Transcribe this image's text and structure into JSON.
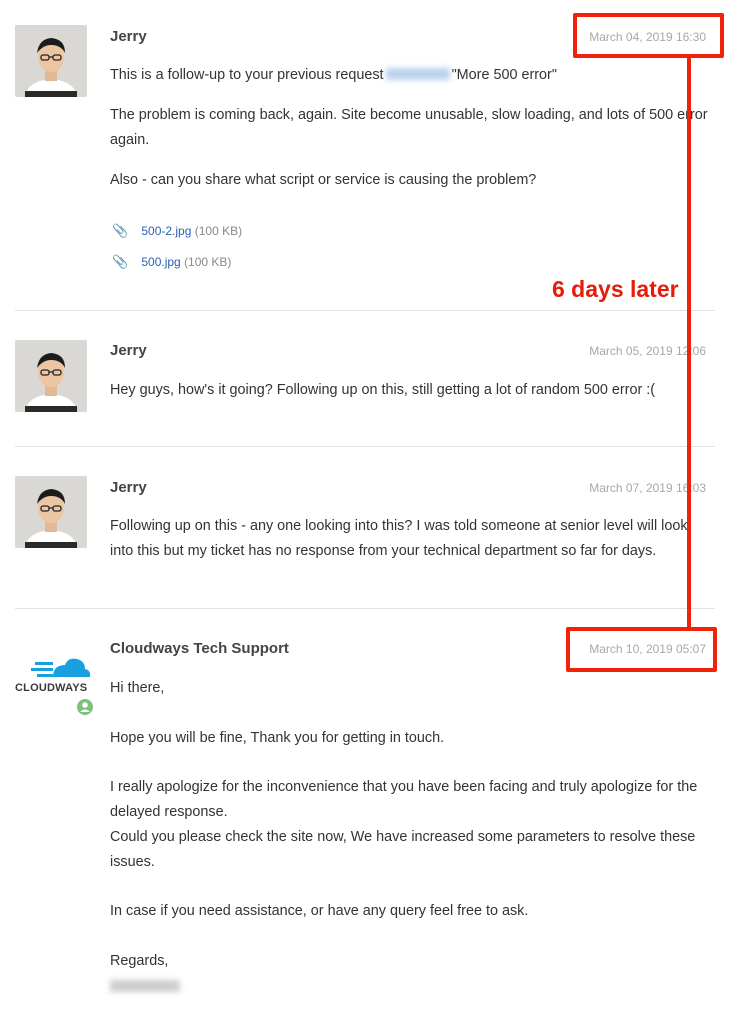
{
  "messages": [
    {
      "author": "Jerry",
      "date": "March 04, 2019 16:30",
      "line1_before": "This is a follow-up to your previous request",
      "line1_after": "\"More 500 error\"",
      "para2": "The problem is coming back, again. Site become unusable, slow loading, and lots of 500 error again.",
      "para3": "Also - can you share what script or service is causing the problem?",
      "attachments": [
        {
          "name": "500-2.jpg",
          "size": "(100 KB)"
        },
        {
          "name": "500.jpg",
          "size": "(100 KB)"
        }
      ]
    },
    {
      "author": "Jerry",
      "date": "March 05, 2019 12:06",
      "body": "Hey guys, how's it going? Following up on this, still getting a lot of random 500 error :("
    },
    {
      "author": "Jerry",
      "date": "March 07, 2019 16:03",
      "body": "Following up on this - any one looking into this? I was told someone at senior level will look into this but my ticket has no response from your technical department so far for days."
    },
    {
      "author": "Cloudways Tech Support",
      "date": "March 10, 2019 05:07",
      "logo_text": "CLOUDWAYS",
      "greeting": "Hi there,",
      "p1": "Hope you will be fine, Thank you for getting in touch.",
      "p2": "I really apologize for the inconvenience that you have been facing and truly apologize for the delayed response.",
      "p3": "Could you please check the site now, We have increased some parameters to resolve these issues.",
      "p4": "In case if you need assistance, or have any query feel free to ask.",
      "regards": "Regards,"
    }
  ],
  "annotation": {
    "text": "6 days later",
    "color": "#e61b0a"
  },
  "colors": {
    "link": "#2a62b9",
    "date": "#a8a8a8",
    "separator": "#e3e3e3",
    "brand": "#1aa0e0"
  },
  "icons": [
    "paperclip-icon",
    "cloudways-logo-icon",
    "agent-badge-icon",
    "user-avatar"
  ]
}
